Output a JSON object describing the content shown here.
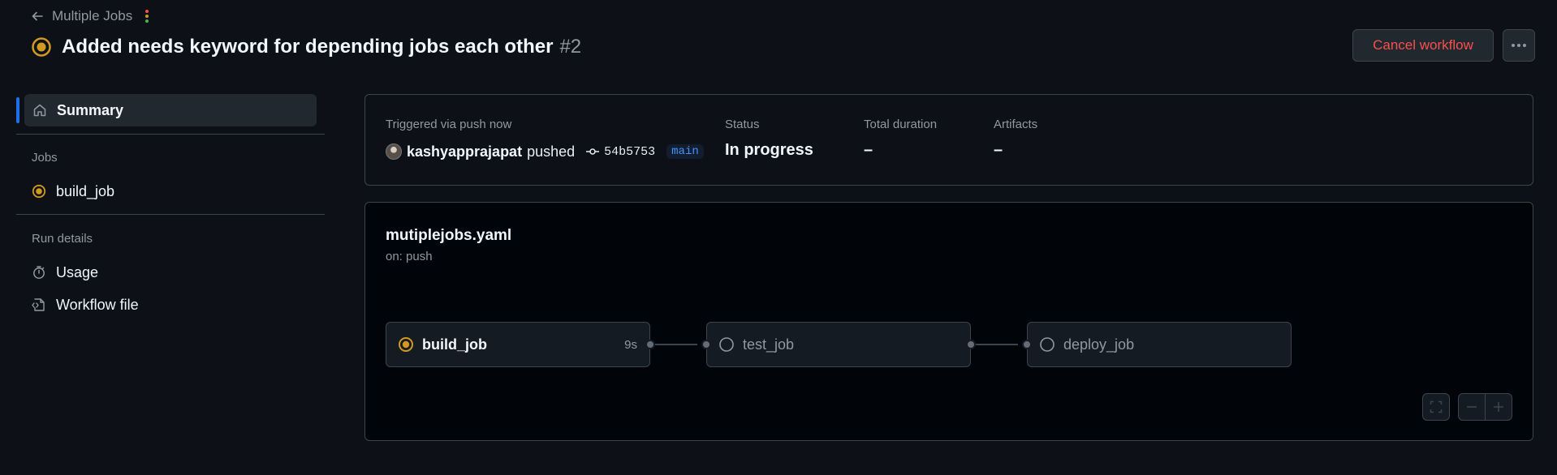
{
  "header": {
    "back_label": "Multiple Jobs",
    "title": "Added needs keyword for depending jobs each other",
    "run_number": "#2",
    "cancel_label": "Cancel workflow"
  },
  "sidebar": {
    "summary_label": "Summary",
    "jobs_section": "Jobs",
    "jobs": [
      {
        "label": "build_job"
      }
    ],
    "run_details_section": "Run details",
    "details": [
      {
        "label": "Usage"
      },
      {
        "label": "Workflow file"
      }
    ]
  },
  "summary": {
    "trigger_label": "Triggered via push now",
    "actor": "kashyapprajapat",
    "action": "pushed",
    "commit": "54b5753",
    "branch": "main",
    "status_label": "Status",
    "status_value": "In progress",
    "duration_label": "Total duration",
    "duration_value": "–",
    "artifacts_label": "Artifacts",
    "artifacts_value": "–"
  },
  "graph": {
    "workflow_name": "mutiplejobs.yaml",
    "trigger": "on: push",
    "jobs": [
      {
        "name": "build_job",
        "duration": "9s",
        "status": "in_progress"
      },
      {
        "name": "test_job",
        "duration": "",
        "status": "queued"
      },
      {
        "name": "deploy_job",
        "duration": "",
        "status": "queued"
      }
    ]
  },
  "colors": {
    "background": "#0d1117",
    "accent": "#1f6feb",
    "in_progress": "#d29922",
    "danger": "#f85149",
    "branch": "#4493f8"
  },
  "icons": [
    "arrow-left-icon",
    "in-progress-icon",
    "home-icon",
    "stopwatch-icon",
    "file-code-icon",
    "commit-icon",
    "queued-icon",
    "fullscreen-icon",
    "zoom-out-icon",
    "zoom-in-icon",
    "kebab-icon"
  ]
}
